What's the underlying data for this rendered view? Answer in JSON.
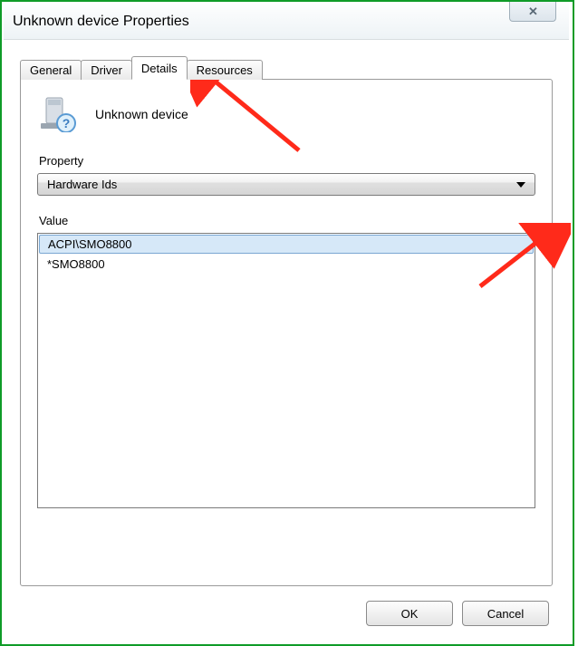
{
  "window": {
    "title": "Unknown device Properties"
  },
  "tabs": {
    "general": "General",
    "driver": "Driver",
    "details": "Details",
    "resources": "Resources"
  },
  "details": {
    "device_name": "Unknown device",
    "property_label": "Property",
    "property_selected": "Hardware Ids",
    "value_label": "Value",
    "values": [
      "ACPI\\SMO8800",
      "*SMO8800"
    ]
  },
  "buttons": {
    "ok": "OK",
    "cancel": "Cancel"
  }
}
